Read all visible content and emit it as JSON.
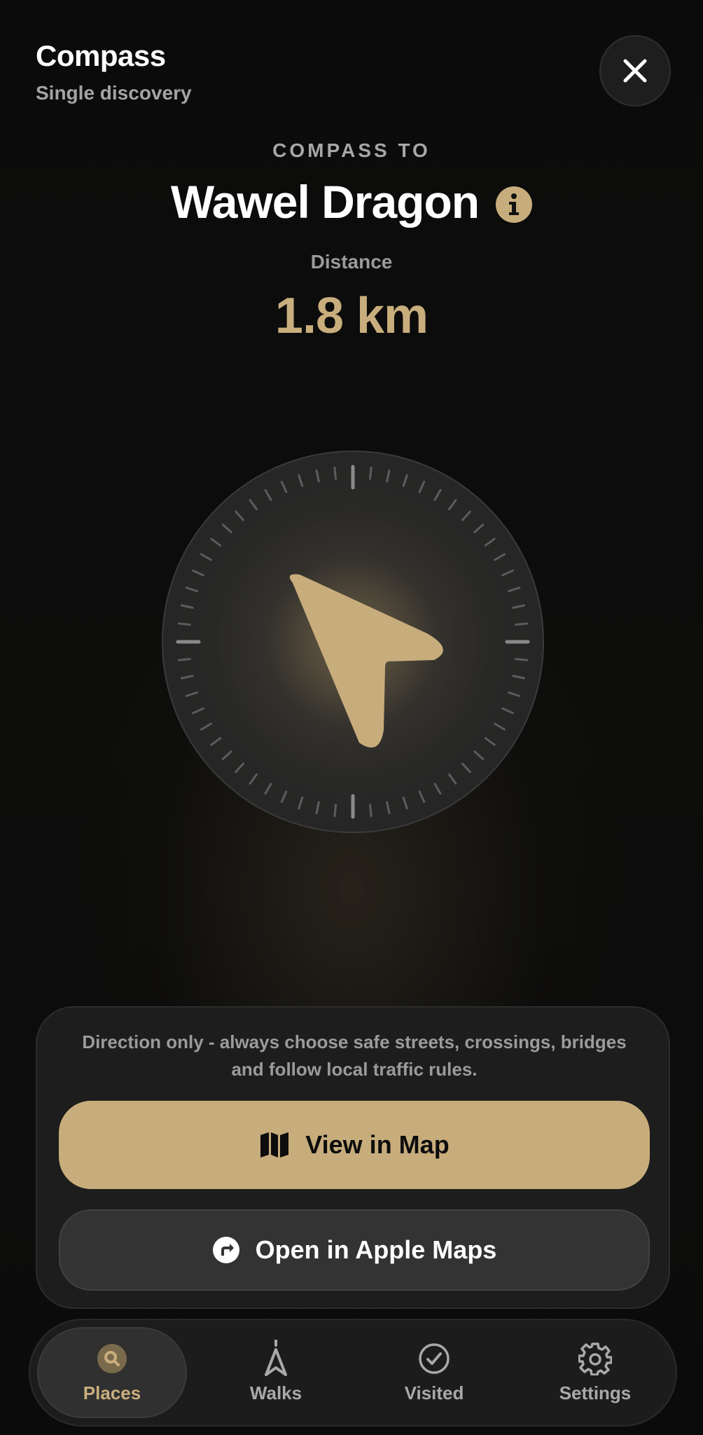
{
  "header": {
    "title": "Compass",
    "subtitle": "Single discovery"
  },
  "target": {
    "eyebrow": "COMPASS TO",
    "name": "Wawel Dragon",
    "distance_label": "Distance",
    "distance_value": "1.8 km"
  },
  "compass": {
    "arrow_color": "#c8ad7c",
    "icon": "navigation-arrow-icon"
  },
  "panel": {
    "note": "Direction only - always choose safe streets, crossings, bridges and follow local traffic rules.",
    "primary_label": "View in Map",
    "secondary_label": "Open in Apple Maps"
  },
  "tabs": [
    {
      "label": "Places",
      "icon": "search-icon",
      "active": true
    },
    {
      "label": "Walks",
      "icon": "walk-arrow-icon",
      "active": false
    },
    {
      "label": "Visited",
      "icon": "check-circle-icon",
      "active": false
    },
    {
      "label": "Settings",
      "icon": "gear-icon",
      "active": false
    }
  ],
  "colors": {
    "accent": "#c8ad7c",
    "background": "#0a0a0a",
    "surface": "#1d1d1d"
  }
}
